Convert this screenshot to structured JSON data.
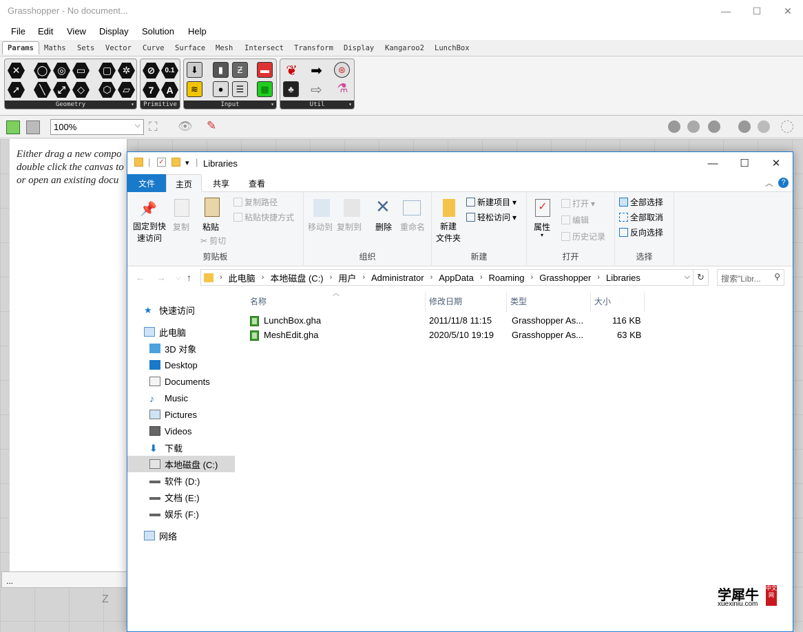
{
  "grasshopper": {
    "title": "Grasshopper - No document...",
    "menu": [
      "File",
      "Edit",
      "View",
      "Display",
      "Solution",
      "Help"
    ],
    "tabs": [
      "Params",
      "Maths",
      "Sets",
      "Vector",
      "Curve",
      "Surface",
      "Mesh",
      "Intersect",
      "Transform",
      "Display",
      "Kangaroo2",
      "LunchBox"
    ],
    "groups": [
      "Geometry",
      "Primitive",
      "Input",
      "Util"
    ],
    "primitive_glyphs": [
      "0.1",
      "7",
      "A"
    ],
    "zoom": "100%",
    "hint_lines": [
      "Either drag a new compo",
      "double click the canvas to",
      "or open an existing docu"
    ],
    "status": "..."
  },
  "explorer": {
    "path_title": "Libraries",
    "tabs": {
      "file": "文件",
      "home": "主页",
      "share": "共享",
      "view": "查看"
    },
    "ribbon": {
      "clipboard": {
        "label": "剪贴板",
        "pin": "固定到快\n速访问",
        "copy": "复制",
        "paste": "粘贴",
        "copy_path": "复制路径",
        "paste_shortcut": "粘贴快捷方式",
        "cut": "剪切"
      },
      "organize": {
        "label": "组织",
        "move_to": "移动到",
        "copy_to": "复制到",
        "delete": "删除",
        "rename": "重命名"
      },
      "new": {
        "label": "新建",
        "new_folder": "新建\n文件夹",
        "new_item": "新建项目",
        "easy_access": "轻松访问"
      },
      "open": {
        "label": "打开",
        "properties": "属性",
        "open": "打开",
        "edit": "编辑",
        "history": "历史记录"
      },
      "select": {
        "label": "选择",
        "select_all": "全部选择",
        "select_none": "全部取消",
        "invert": "反向选择"
      }
    },
    "breadcrumb": [
      "此电脑",
      "本地磁盘 (C:)",
      "用户",
      "Administrator",
      "AppData",
      "Roaming",
      "Grasshopper",
      "Libraries"
    ],
    "search_placeholder": "搜索\"Libr...",
    "nav": {
      "quick_access": "快速访问",
      "this_pc": "此电脑",
      "items": [
        "3D 对象",
        "Desktop",
        "Documents",
        "Music",
        "Pictures",
        "Videos",
        "下载",
        "本地磁盘 (C:)",
        "软件 (D:)",
        "文档 (E:)",
        "娱乐 (F:)"
      ],
      "network": "网络"
    },
    "columns": [
      "名称",
      "修改日期",
      "类型",
      "大小"
    ],
    "files": [
      {
        "name": "LunchBox.gha",
        "date": "2011/11/8 11:15",
        "type": "Grasshopper As...",
        "size": "116 KB"
      },
      {
        "name": "MeshEdit.gha",
        "date": "2020/5/10 19:19",
        "type": "Grasshopper As...",
        "size": "63 KB"
      }
    ]
  },
  "watermark": {
    "main": "学犀牛",
    "site": "xuexiniu.com",
    "tag": "中文网"
  }
}
